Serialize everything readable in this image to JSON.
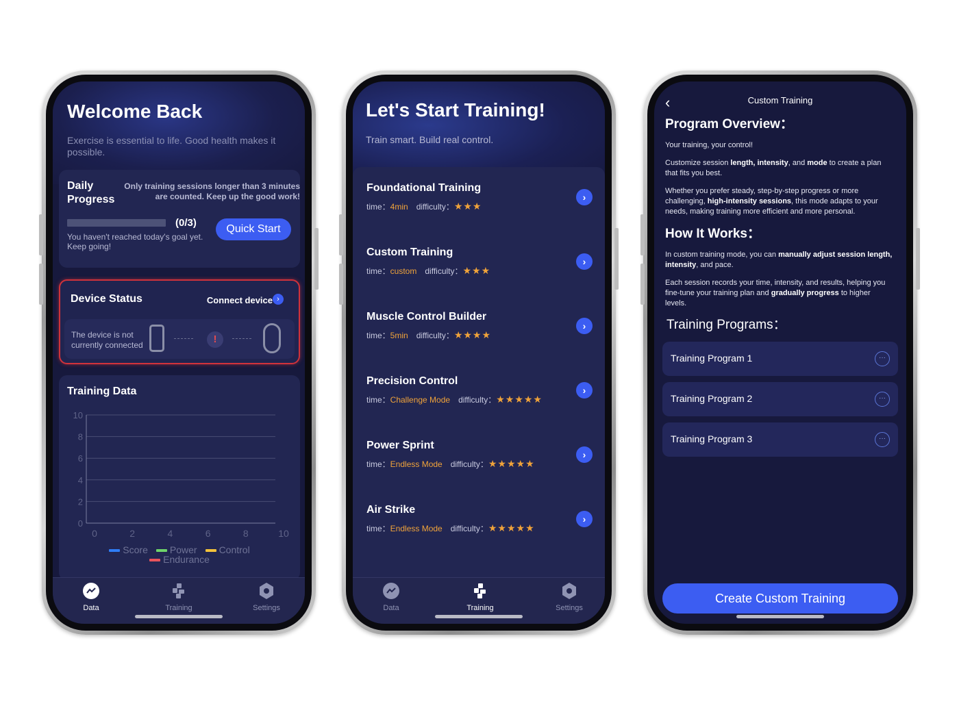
{
  "screen1": {
    "title": "Welcome Back",
    "subtitle": "Exercise is essential to life. Good health makes it possible.",
    "daily": {
      "title": "Daily Progress",
      "note": "Only training sessions longer than 3 minutes are counted. Keep up the good work!",
      "progress_count": "(0/3)",
      "progress_fraction": 0,
      "message": "You haven't reached today's goal yet. Keep going!",
      "button": "Quick Start"
    },
    "device": {
      "title": "Device Status",
      "connect_label": "Connect device",
      "status_text": "The device is not currently connected",
      "alert_symbol": "!"
    },
    "training_data": {
      "title": "Training Data"
    },
    "chart_data": {
      "type": "line",
      "title": "Training Data",
      "x_ticks": [
        0,
        2,
        4,
        6,
        8,
        10
      ],
      "y_ticks": [
        0,
        2,
        4,
        6,
        8,
        10
      ],
      "xlim": [
        0,
        10
      ],
      "ylim": [
        0,
        10
      ],
      "grid": true,
      "legend_position": "bottom",
      "series": [
        {
          "name": "Score",
          "color": "#2f7df6",
          "values": []
        },
        {
          "name": "Power",
          "color": "#6fd46a",
          "values": []
        },
        {
          "name": "Control",
          "color": "#f3c23b",
          "values": []
        },
        {
          "name": "Endurance",
          "color": "#e8545c",
          "values": []
        }
      ]
    },
    "tabs": [
      {
        "label": "Data",
        "icon": "chart-icon",
        "active": true
      },
      {
        "label": "Training",
        "icon": "training-icon",
        "active": false
      },
      {
        "label": "Settings",
        "icon": "settings-icon",
        "active": false
      }
    ]
  },
  "screen2": {
    "title": "Let's Start Training!",
    "subtitle": "Train smart. Build real control.",
    "time_label": "time：",
    "difficulty_label": "difficulty：",
    "trainings": [
      {
        "name": "Foundational Training",
        "time": "4min",
        "stars": "★★★",
        "difficulty": 3
      },
      {
        "name": "Custom Training",
        "time": "custom",
        "stars": "★★★",
        "difficulty": 3
      },
      {
        "name": "Muscle Control Builder",
        "time": "5min",
        "stars": "★★★★",
        "difficulty": 4
      },
      {
        "name": "Precision Control",
        "time": "Challenge Mode",
        "stars": "★★★★★",
        "difficulty": 5
      },
      {
        "name": "Power Sprint",
        "time": "Endless Mode",
        "stars": "★★★★★",
        "difficulty": 5
      },
      {
        "name": "Air Strike",
        "time": "Endless Mode",
        "stars": "★★★★★",
        "difficulty": 5
      }
    ],
    "tabs": [
      {
        "label": "Data",
        "icon": "chart-icon",
        "active": false
      },
      {
        "label": "Training",
        "icon": "training-icon",
        "active": true
      },
      {
        "label": "Settings",
        "icon": "settings-icon",
        "active": false
      }
    ]
  },
  "screen3": {
    "header": "Custom Training",
    "overview_title": "Program Overview：",
    "overview_p1": "Your training, your control!",
    "overview_p2": {
      "a": "Customize session ",
      "b": "length, intensity",
      "c": ", and ",
      "d": "mode",
      "e": " to create a plan that fits you best."
    },
    "overview_p3": {
      "a": "Whether you prefer steady, step-by-step progress or more challenging, ",
      "b": "high-intensity sessions",
      "c": ", this mode adapts to your needs, making training more efficient and more personal."
    },
    "how_title": "How It Works：",
    "how_p1": {
      "a": "In custom training mode, you can ",
      "b": "manually adjust session length, intensity",
      "c": ", and pace."
    },
    "how_p2": {
      "a": "Each session records your time, intensity, and results, helping you fine-tune your training plan and ",
      "b": "gradually progress",
      "c": " to higher levels."
    },
    "programs_title": "Training Programs：",
    "programs": [
      "Training Program 1",
      "Training Program 2",
      "Training Program 3"
    ],
    "more_symbol": "···",
    "create_button": "Create Custom Training"
  },
  "colors": {
    "background": "#17193d",
    "card": "#222652",
    "accent": "#3c5df2",
    "highlight": "#f0a33a",
    "alert": "#d0323b"
  }
}
